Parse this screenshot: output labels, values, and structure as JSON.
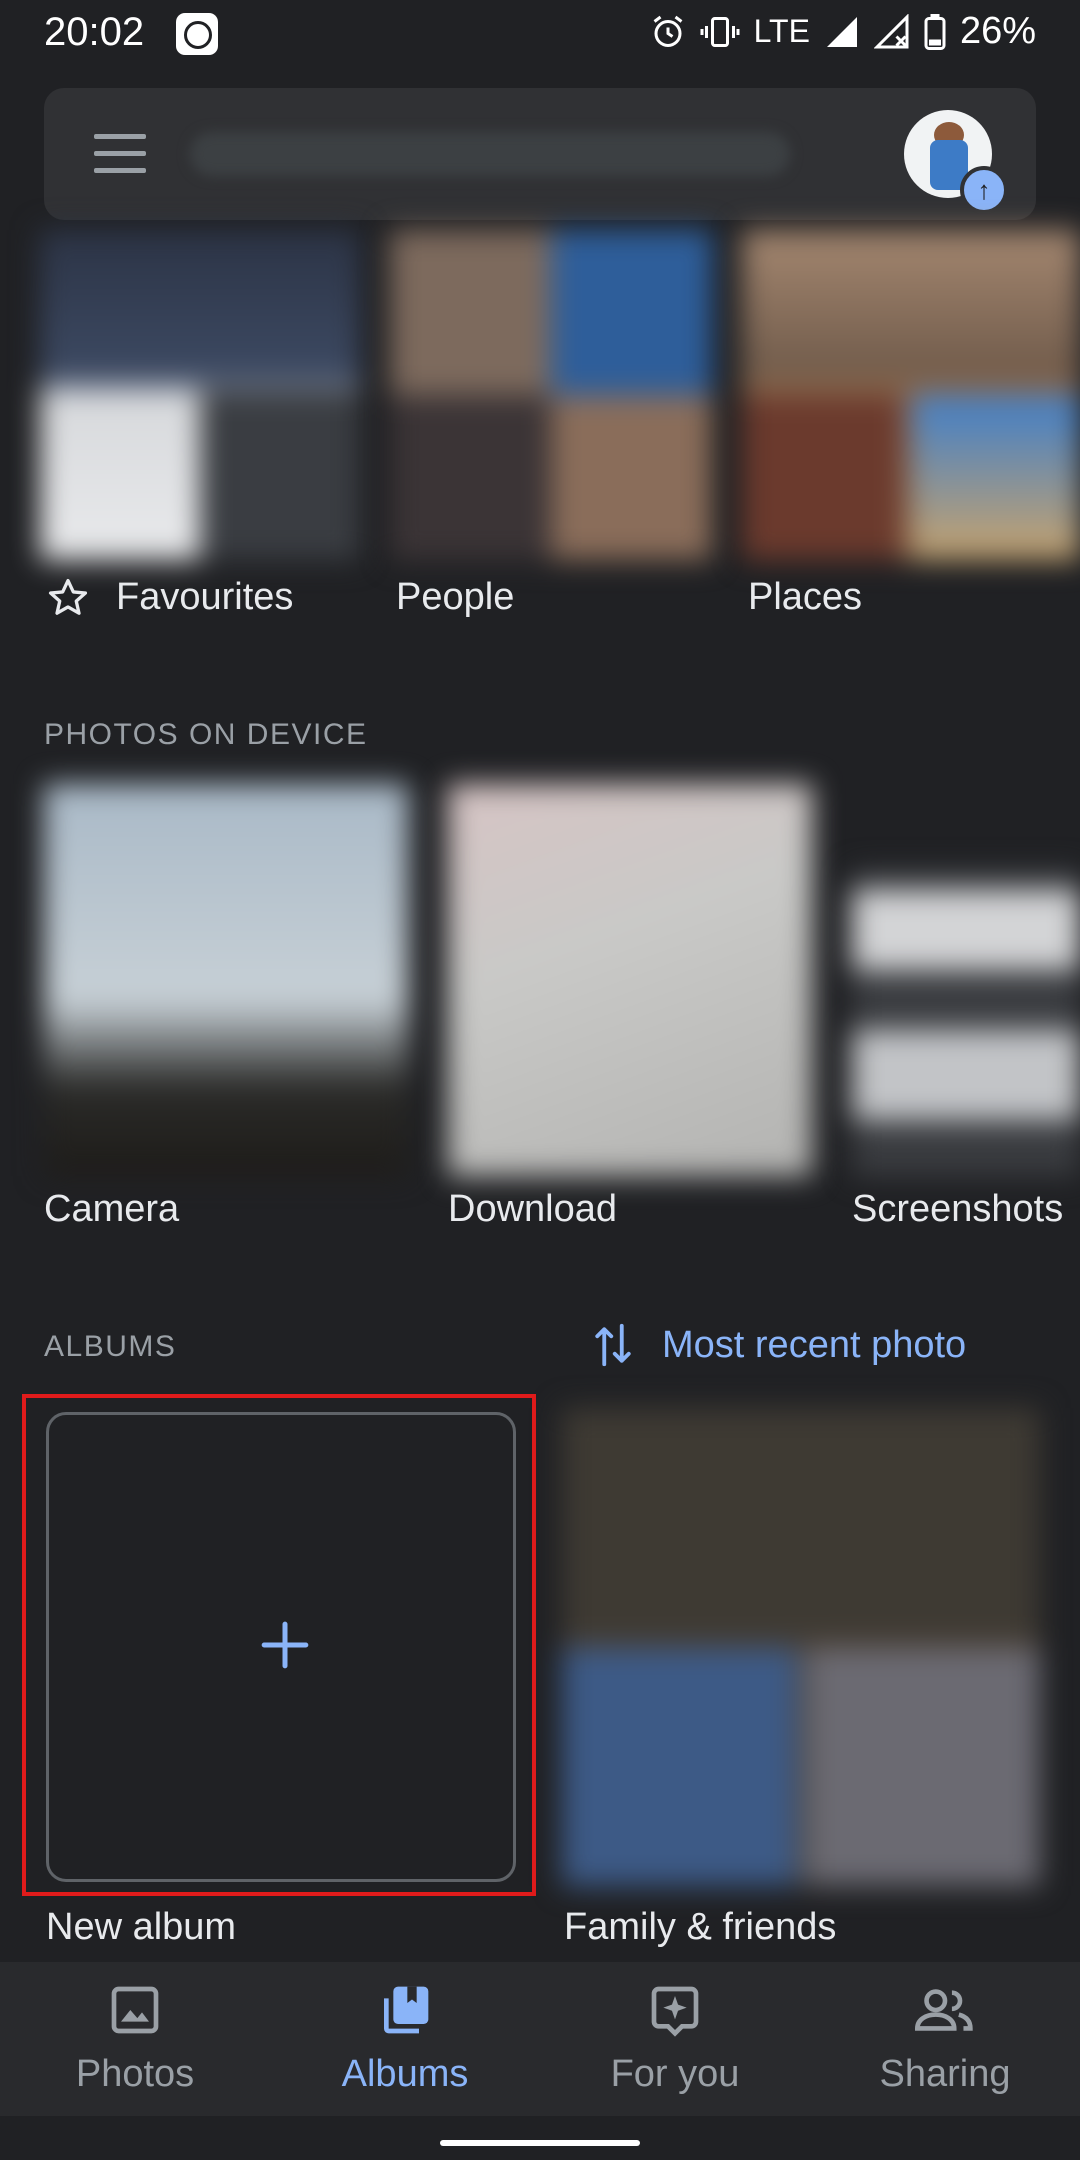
{
  "status": {
    "time": "20:02",
    "network": "LTE",
    "battery": "26%"
  },
  "search": {
    "placeholder": ""
  },
  "top_tiles": [
    {
      "label": "Favourites",
      "icon": "star-outline-icon"
    },
    {
      "label": "People"
    },
    {
      "label": "Places"
    }
  ],
  "device_section": {
    "title": "PHOTOS ON DEVICE",
    "items": [
      {
        "label": "Camera"
      },
      {
        "label": "Download"
      },
      {
        "label": "Screenshots"
      }
    ]
  },
  "albums_section": {
    "title": "ALBUMS",
    "sort_label": "Most recent photo",
    "items": [
      {
        "label": "New album",
        "icon": "plus-icon"
      },
      {
        "label": "Family & friends"
      }
    ]
  },
  "bottom_nav": [
    {
      "label": "Photos",
      "icon": "photo-icon",
      "active": false
    },
    {
      "label": "Albums",
      "icon": "albums-icon",
      "active": true
    },
    {
      "label": "For you",
      "icon": "for-you-icon",
      "active": false
    },
    {
      "label": "Sharing",
      "icon": "people-icon",
      "active": false
    }
  ],
  "colors": {
    "background": "#202124",
    "accent": "#8ab4f8",
    "highlight": "#e01b1b",
    "nav_inactive": "#9aa0a6"
  }
}
